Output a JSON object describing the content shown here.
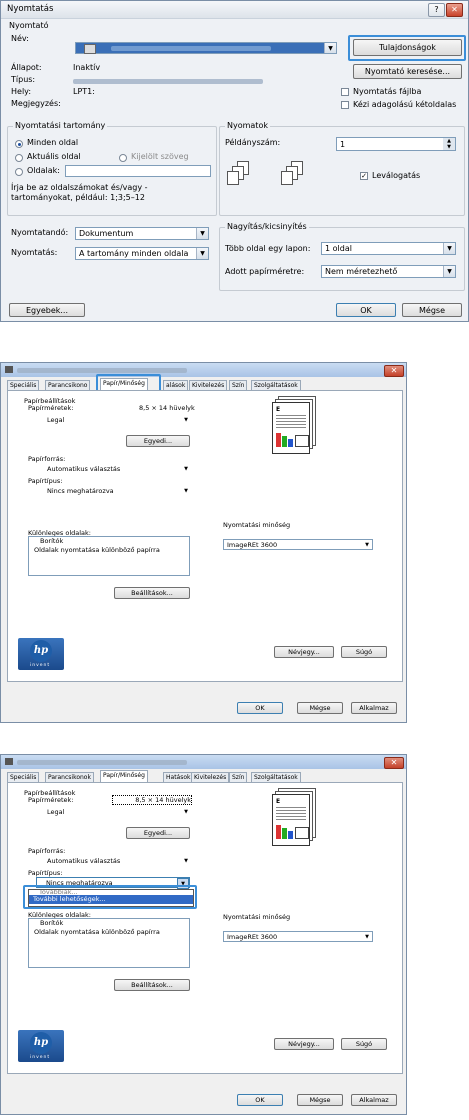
{
  "print_dialog": {
    "title": "Nyomtatás",
    "printer_group": "Nyomtató",
    "name_label": "Név:",
    "status_label": "Állapot:",
    "status_value": "Inaktív",
    "type_label": "Típus:",
    "where_label": "Hely:",
    "where_value": "LPT1:",
    "comment_label": "Megjegyzés:",
    "properties_button": "Tulajdonságok",
    "find_printer_button": "Nyomtató keresése...",
    "print_to_file": "Nyomtatás fájlba",
    "manual_duplex": "Kézi adagolású kétoldalas",
    "range_group": "Nyomtatási tartomány",
    "all_pages": "Minden oldal",
    "current_page": "Aktuális oldal",
    "selection": "Kijelölt szöveg",
    "pages": "Oldalak:",
    "range_hint": "Írja be az oldalszámokat és/vagy -tartományokat, például: 1;3;5–12",
    "copies_group": "Nyomatok",
    "copies_label": "Példányszám:",
    "copies_value": "1",
    "collate": "Leválogatás",
    "print_what_label": "Nyomtatandó:",
    "print_what_value": "Dokumentum",
    "print_label": "Nyomtatás:",
    "print_value": "A tartomány minden oldala",
    "zoom_group": "Nagyítás/kicsinyítés",
    "pages_per_sheet_label": "Több oldal egy lapon:",
    "pages_per_sheet_value": "1 oldal",
    "scale_label": "Adott papírméretre:",
    "scale_value": "Nem méretezhető",
    "options_button": "Egyebek...",
    "ok_button": "OK",
    "cancel_button": "Mégse",
    "help_glyph": "?",
    "close_glyph": "✕"
  },
  "props_dialog": {
    "tabs": [
      "Speciális",
      "Parancsikonok",
      "Papír/Minőség",
      "Hatások",
      "Kivitelezés",
      "Szín",
      "Szolgáltatások"
    ],
    "tabs_cropped": [
      "Speciális",
      "Parancsikono",
      "Papír/Minőség",
      "alások",
      "Kivitelezés",
      "Szín",
      "Szolgáltatások"
    ],
    "paper_options": "Papírbeállítások",
    "paper_sizes": "Papírméretek:",
    "paper_size_value": "8,5 × 14 hüvelyk",
    "paper_size_selected": "Legal",
    "custom_button": "Egyedi...",
    "paper_source_label": "Papírforrás:",
    "paper_source_value": "Automatikus választás",
    "paper_type_label": "Papírtípus:",
    "paper_type_value": "Nincs meghatározva",
    "special_pages_label": "Különleges oldalak:",
    "special_pages_items": [
      "Borítók",
      "Oldalak nyomtatása különböző papírra"
    ],
    "settings_button": "Beállítások...",
    "print_quality_label": "Nyomtatási minőség",
    "print_quality_value": "ImageREt 3600",
    "about_button": "Névjegy...",
    "help_button": "Súgó",
    "ok_button": "OK",
    "cancel_button": "Mégse",
    "apply_button": "Alkalmaz",
    "logo_text": "hp",
    "invent_text": "invent",
    "dropdown_items": [
      "Továbbiak...",
      "További lehetőségek..."
    ],
    "close_glyph": "✕"
  },
  "colors": {
    "highlight": "#3b8ed8",
    "selection": "#316ac5",
    "hp_blue": "#1f5ea8"
  }
}
